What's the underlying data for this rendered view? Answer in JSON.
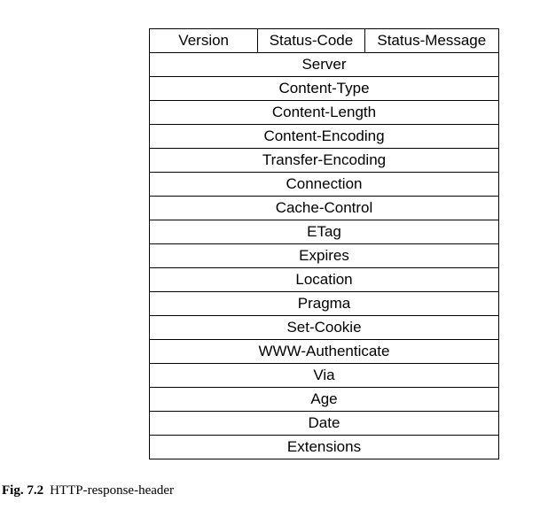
{
  "table": {
    "first_row": {
      "version": "Version",
      "status_code": "Status-Code",
      "status_message": "Status-Message"
    },
    "fields": [
      "Server",
      "Content-Type",
      "Content-Length",
      "Content-Encoding",
      "Transfer-Encoding",
      "Connection",
      "Cache-Control",
      "ETag",
      "Expires",
      "Location",
      "Pragma",
      "Set-Cookie",
      "WWW-Authenticate",
      "Via",
      "Age",
      "Date",
      "Extensions"
    ]
  },
  "caption": {
    "label": "Fig. 7.2",
    "text": "HTTP-response-header"
  }
}
